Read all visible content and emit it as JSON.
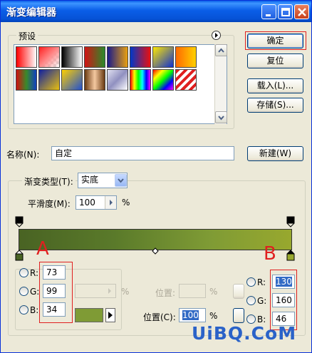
{
  "window": {
    "title": "渐变编辑器"
  },
  "presets": {
    "label": "预设",
    "swatches": [
      "linear-gradient(90deg,#ff0000,#ffffff)",
      "linear-gradient(135deg,#ff2020 0%,#ff8a8a 50%,rgba(255,255,255,0) 100%), repeating-conic-gradient(#ddd 0 25%, #fff 0 50%) 0 0/8px 8px",
      "linear-gradient(90deg,#000,#fff)",
      "linear-gradient(90deg,#d21414,#2a8a2a)",
      "linear-gradient(90deg,#1a1a8a,#e8a010)",
      "linear-gradient(90deg,#0038c8,#e81010)",
      "linear-gradient(135deg,#ffe800,#1030d0)",
      "linear-gradient(90deg,#ff6a00,#ffd000)",
      "linear-gradient(90deg,#d01010,#3a8a2a,#1040c0)",
      "linear-gradient(135deg,#1020a0,#e8c010)",
      "linear-gradient(135deg,#ffd000 0%,#2050d0 100%)",
      "linear-gradient(90deg,#6a3a10,#f4c8a0,#6a3a10)",
      "linear-gradient(135deg,#e0e0f0,#9090c0,#ffffff)",
      "linear-gradient(90deg,#ff0000,#ffff00,#00ff00,#00ffff,#0000ff,#ff00ff)",
      "linear-gradient(135deg,#ff0000,#ffff00,#00ff00,#0000ff,#ff00ff)",
      "repeating-linear-gradient(135deg,#e02020 0 4px,#ffffff 4px 8px)"
    ]
  },
  "buttons": {
    "ok": "确定",
    "reset": "复位",
    "load": "载入(L)...",
    "save": "存储(S)...",
    "new": "新建(W)"
  },
  "name": {
    "label": "名称(N):",
    "value": "自定"
  },
  "gradient_type": {
    "label": "渐变类型(T):",
    "value": "实底"
  },
  "smoothness": {
    "label": "平滑度(M):",
    "value": "100",
    "unit": "%"
  },
  "annotations": {
    "a": "A",
    "b": "B"
  },
  "left_color": {
    "r_label": "R:",
    "g_label": "G:",
    "b_label": "B:",
    "r": "73",
    "g": "99",
    "b": "34",
    "swatch": "#7f9b35"
  },
  "opacity_stop": {
    "unit": "%",
    "position_label": "位置:",
    "position_unit": "%"
  },
  "color_stop": {
    "position_label": "位置(C):",
    "position_value": "100",
    "position_unit": "%"
  },
  "right_color": {
    "r_label": "R:",
    "g_label": "G:",
    "b_label": "B:",
    "r": "130",
    "g": "160",
    "b": "46"
  },
  "watermark": "UiBQ.CoM"
}
